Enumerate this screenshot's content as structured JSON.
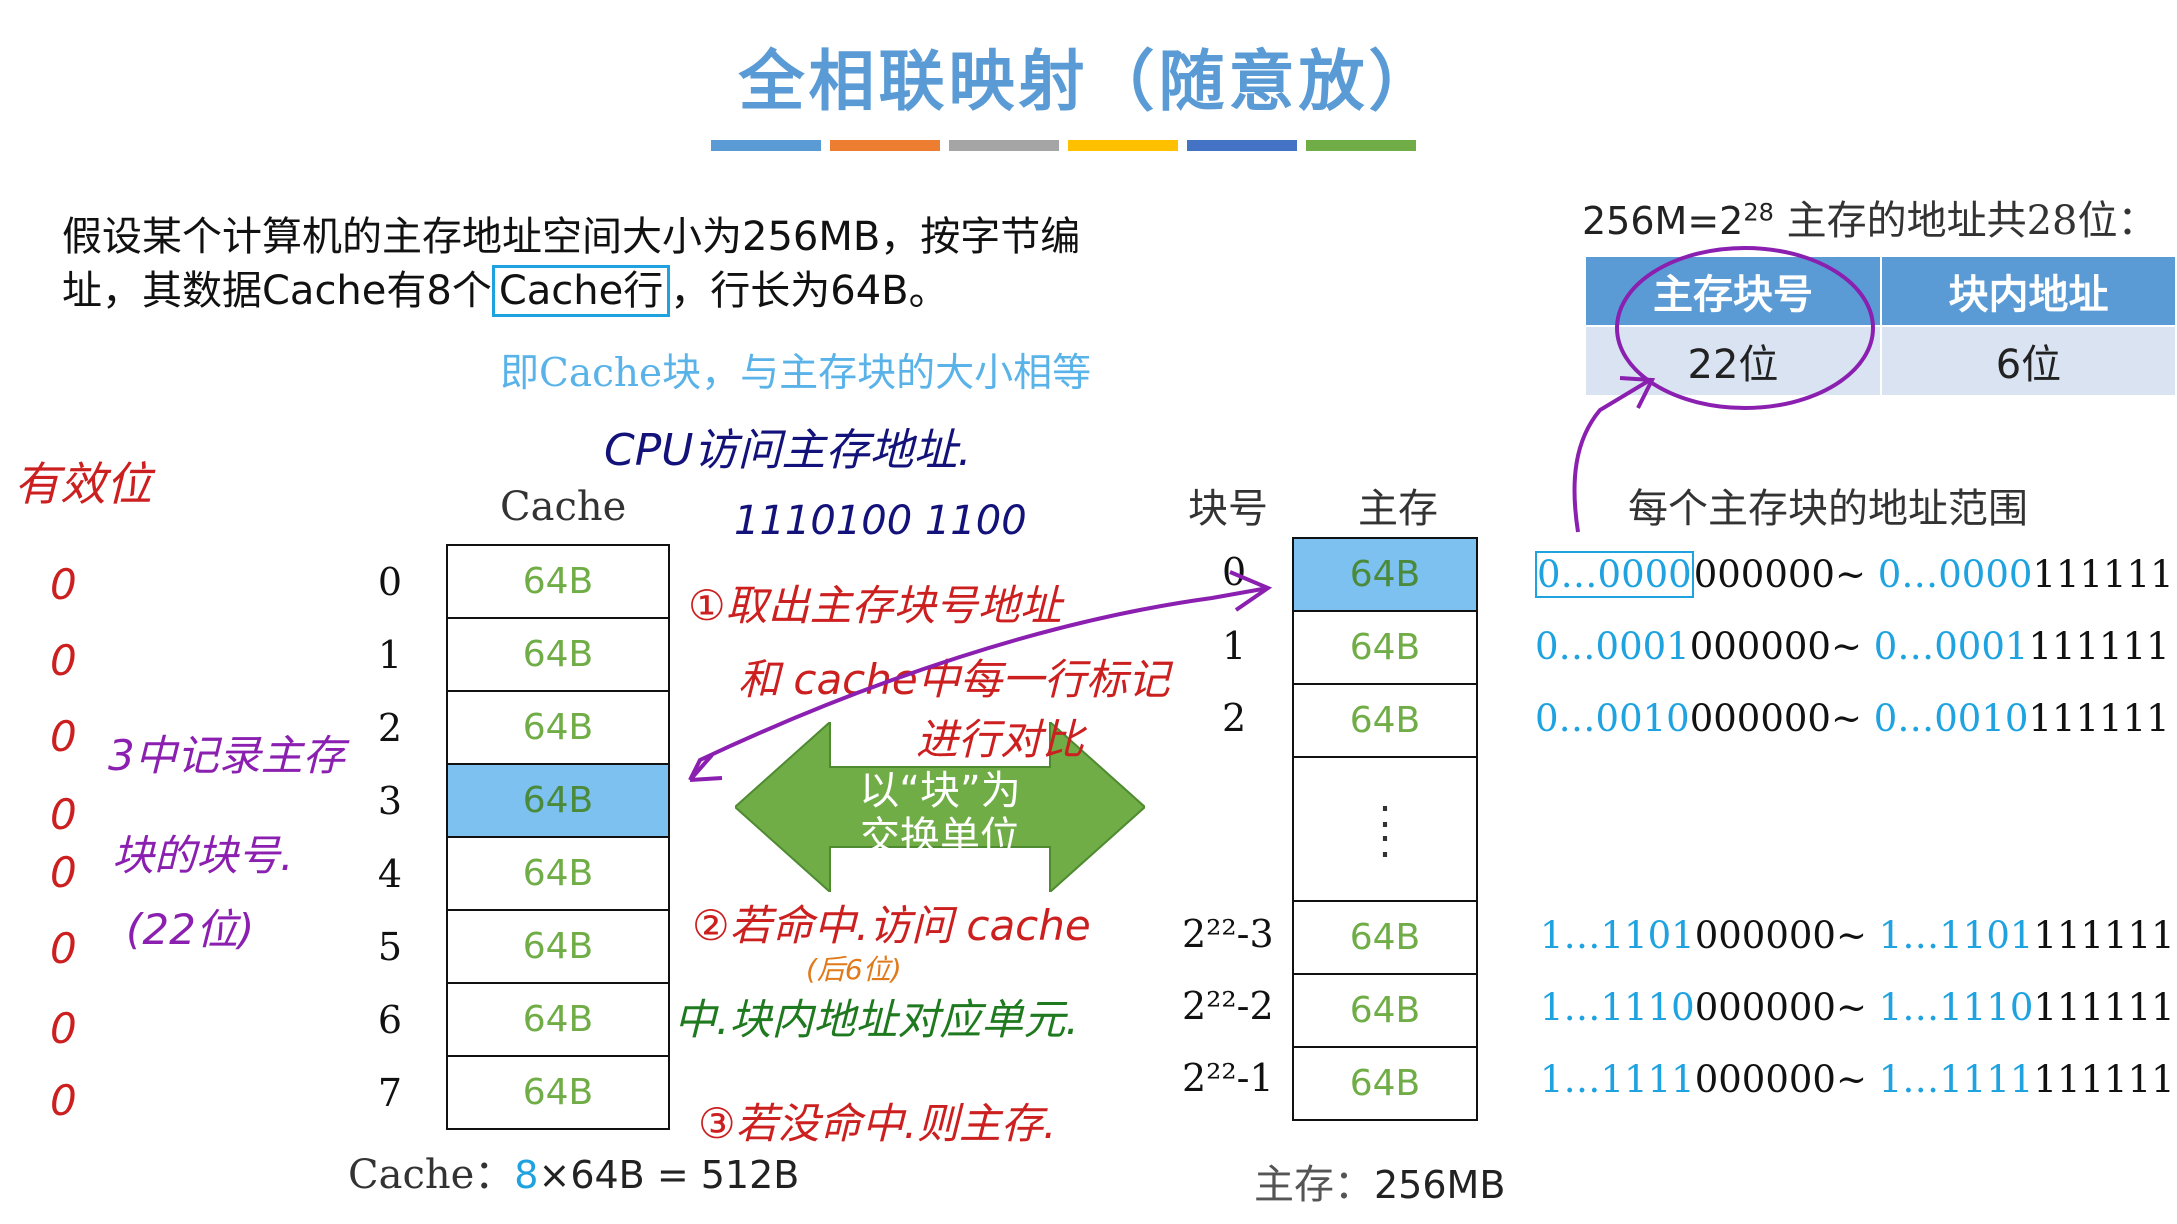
{
  "title": "全相联映射（随意放）",
  "color_bars": [
    "#5b9bd5",
    "#ed7d31",
    "#a5a5a5",
    "#ffc000",
    "#4472c4",
    "#70ad47"
  ],
  "intro": {
    "line1": "假设某个计算机的主存地址空间大小为256MB，按字节编",
    "line2_pre": "址，其数据Cache有8个",
    "line2_box": "Cache行",
    "line2_post": "，行长为64B。"
  },
  "note_blue": "即Cache块，与主存块的大小相等",
  "addr_summary": {
    "prefix": "256M=2",
    "exp": "28",
    "suffix": " 主存的地址共28位："
  },
  "addr_table": {
    "headers": [
      "主存块号",
      "块内地址"
    ],
    "values": [
      "22位",
      "6位"
    ]
  },
  "cache": {
    "label": "Cache",
    "rows": [
      {
        "index": "0",
        "size": "64B"
      },
      {
        "index": "1",
        "size": "64B"
      },
      {
        "index": "2",
        "size": "64B"
      },
      {
        "index": "3",
        "size": "64B"
      },
      {
        "index": "4",
        "size": "64B"
      },
      {
        "index": "5",
        "size": "64B"
      },
      {
        "index": "6",
        "size": "64B"
      },
      {
        "index": "7",
        "size": "64B"
      }
    ],
    "highlight_index": 3,
    "caption_pre": "Cache：",
    "caption_num": "8",
    "caption_post": "×64B = 512B"
  },
  "arrow_text": {
    "line1": "以“块”为",
    "line2": "交换单位"
  },
  "memory": {
    "block_header": "块号",
    "label": "主存",
    "range_header": "每个主存块的地址范围",
    "rows": [
      {
        "block": "0",
        "size": "64B",
        "range_a_blue": "0…0000",
        "range_a_black": "000000",
        "sep": "~",
        "range_b_blue": " 0…0000",
        "range_b_black": "111111"
      },
      {
        "block": "1",
        "size": "64B",
        "range_a_blue": "0…0001",
        "range_a_black": "000000",
        "sep": "~",
        "range_b_blue": " 0…0001",
        "range_b_black": "111111"
      },
      {
        "block": "2",
        "size": "64B",
        "range_a_blue": "0…0010",
        "range_a_black": "000000",
        "sep": "~",
        "range_b_blue": " 0…0010",
        "range_b_black": "111111"
      },
      {
        "block": "2²²-3",
        "size": "64B",
        "range_a_blue": "1…1101",
        "range_a_black": "000000",
        "sep": "~",
        "range_b_blue": " 1…1101",
        "range_b_black": "111111"
      },
      {
        "block": "2²²-2",
        "size": "64B",
        "range_a_blue": "1…1110",
        "range_a_black": "000000",
        "sep": "~",
        "range_b_blue": " 1…1110",
        "range_b_black": "111111"
      },
      {
        "block": "2²²-1",
        "size": "64B",
        "range_a_blue": "1…1111",
        "range_a_black": "000000",
        "sep": "~",
        "range_b_blue": " 1…1111",
        "range_b_black": "111111"
      }
    ],
    "dots": ":",
    "caption_pre": "主存：",
    "caption_val": "256MB"
  },
  "handwriting": {
    "valid_bit": "有效位",
    "zeros": [
      "0",
      "0",
      "0",
      "0",
      "0",
      "0",
      "0",
      "0"
    ],
    "cpu_access": "CPU访问主存地址.",
    "binary": "1110100 1100",
    "step1_a": "①取出主存块号地址",
    "step1_b": "和 cache中每一行标记",
    "step1_c": "进行对比",
    "left_note_a": "3中记录主存",
    "left_note_b": "块的块号.",
    "left_note_c": "(22位)",
    "step2_a": "②若命中.访问 cache",
    "step2_sub": "(后6位)",
    "step2_b": "中.块内地址对应单元.",
    "step3": "③若没命中.则主存."
  }
}
